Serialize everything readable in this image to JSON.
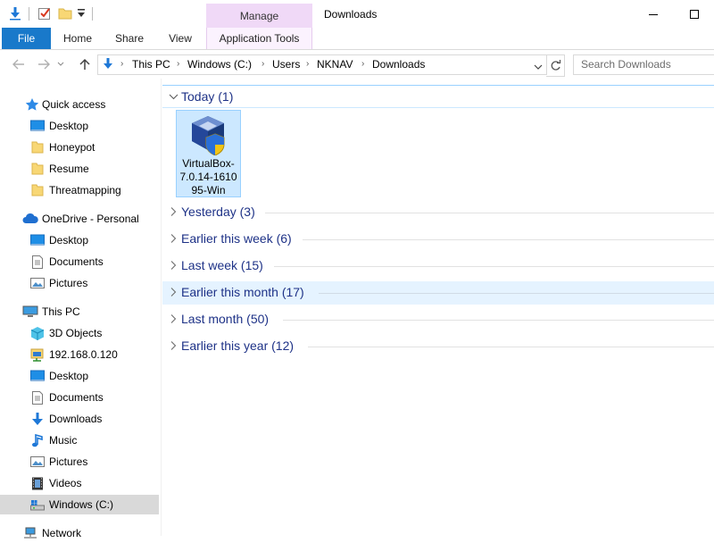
{
  "window": {
    "title": "Downloads",
    "context_tab_group": "Manage"
  },
  "ribbon": {
    "tabs": [
      {
        "label": "File"
      },
      {
        "label": "Home"
      },
      {
        "label": "Share"
      },
      {
        "label": "View"
      },
      {
        "label": "Application Tools"
      }
    ]
  },
  "address": {
    "crumbs": [
      "This PC",
      "Windows (C:)",
      "Users",
      "NKNAV",
      "Downloads"
    ]
  },
  "search": {
    "placeholder": "Search Downloads"
  },
  "nav": {
    "quick_access": "Quick access",
    "quick_items": [
      "Desktop",
      "Honeypot",
      "Resume",
      "Threatmapping"
    ],
    "onedrive": "OneDrive - Personal",
    "onedrive_items": [
      "Desktop",
      "Documents",
      "Pictures"
    ],
    "this_pc": "This PC",
    "pc_items": [
      "3D Objects",
      "192.168.0.120",
      "Desktop",
      "Documents",
      "Downloads",
      "Music",
      "Pictures",
      "Videos",
      "Windows (C:)"
    ],
    "network": "Network"
  },
  "content": {
    "groups": [
      {
        "label": "Today (1)",
        "expanded": true
      },
      {
        "label": "Yesterday (3)",
        "expanded": false
      },
      {
        "label": "Earlier this week (6)",
        "expanded": false
      },
      {
        "label": "Last week (15)",
        "expanded": false
      },
      {
        "label": "Earlier this month (17)",
        "expanded": false
      },
      {
        "label": "Last month (50)",
        "expanded": false
      },
      {
        "label": "Earlier this year (12)",
        "expanded": false
      }
    ],
    "files": [
      {
        "name_lines": [
          "VirtualBox-",
          "7.0.14-1610",
          "95-Win"
        ]
      }
    ]
  },
  "colors": {
    "accent": "#1979ca",
    "selection": "#cce8ff",
    "manage": "#f0d9f7",
    "group_text": "#1e3287"
  }
}
